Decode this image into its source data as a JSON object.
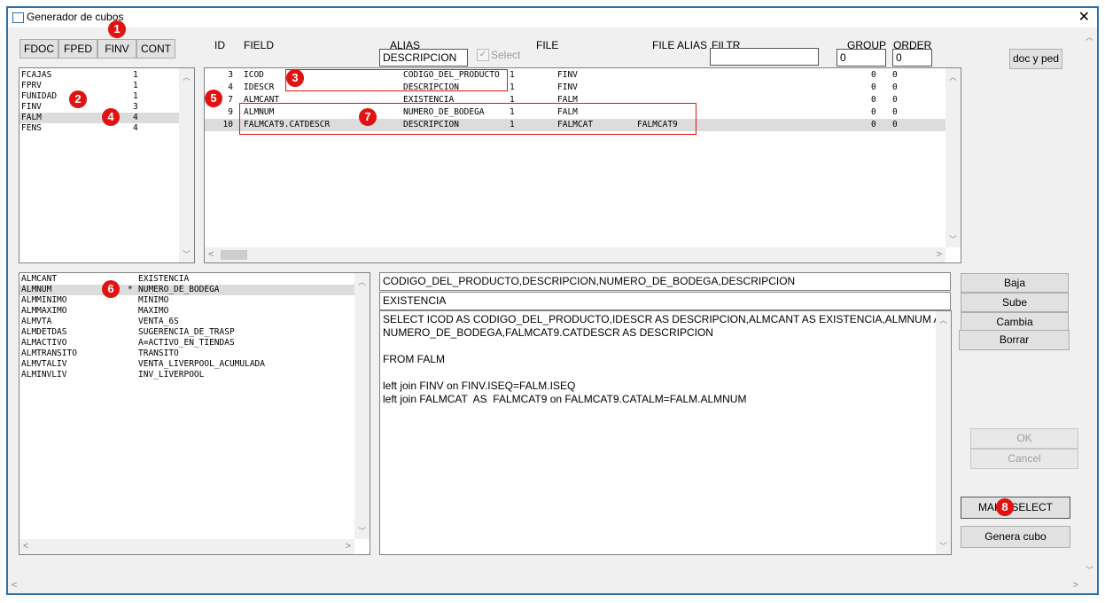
{
  "window": {
    "title": "Generador de cubos",
    "close": "✕"
  },
  "file_tabs": [
    "FDOC",
    "FPED",
    "FINV",
    "CONT"
  ],
  "columns": {
    "id": "ID",
    "field": "FIELD",
    "alias": "ALIAS",
    "file": "FILE",
    "file_alias": "FILE ALIAS",
    "filtr": "FILTR",
    "group": "GROUP",
    "order": "ORDER"
  },
  "alias_input": "DESCRIPCION",
  "select_checkbox_label": "Select",
  "filtr_input": "",
  "group_input": "0",
  "order_input": "0",
  "doc_button": "doc y ped",
  "files_list": [
    {
      "name": "FCAJAS",
      "count": "1"
    },
    {
      "name": "FPRV",
      "count": "1"
    },
    {
      "name": "FUNIDAD",
      "count": "1"
    },
    {
      "name": "FINV",
      "count": "3"
    },
    {
      "name": "FALM",
      "count": "4"
    },
    {
      "name": "FENS",
      "count": "4"
    }
  ],
  "fields_grid": [
    {
      "id": "3",
      "field": "ICOD",
      "alias": "CODIGO_DEL_PRODUCTO",
      "n": "1",
      "file": "FINV",
      "file_alias": "",
      "group": "0",
      "order": "0"
    },
    {
      "id": "4",
      "field": "IDESCR",
      "alias": "DESCRIPCION",
      "n": "1",
      "file": "FINV",
      "file_alias": "",
      "group": "0",
      "order": "0"
    },
    {
      "id": "7",
      "field": "ALMCANT",
      "alias": "EXISTENCIA",
      "n": "1",
      "file": "FALM",
      "file_alias": "",
      "group": "0",
      "order": "0"
    },
    {
      "id": "9",
      "field": "ALMNUM",
      "alias": "NUMERO_DE_BODEGA",
      "n": "1",
      "file": "FALM",
      "file_alias": "",
      "group": "0",
      "order": "0"
    },
    {
      "id": "10",
      "field": "FALMCAT9.CATDESCR",
      "alias": "DESCRIPCION",
      "n": "1",
      "file": "FALMCAT",
      "file_alias": "FALMCAT9",
      "group": "0",
      "order": "0"
    }
  ],
  "available_fields": [
    {
      "name": "ALMCANT",
      "mark": "",
      "alias": "EXISTENCIA"
    },
    {
      "name": "ALMNUM",
      "mark": "*",
      "alias": "NUMERO_DE_BODEGA"
    },
    {
      "name": "ALMMINIMO",
      "mark": "",
      "alias": "MINIMO"
    },
    {
      "name": "ALMMAXIMO",
      "mark": "",
      "alias": "MAXIMO"
    },
    {
      "name": "ALMVTA",
      "mark": "",
      "alias": "VENTA_6S"
    },
    {
      "name": "ALMDETDAS",
      "mark": "",
      "alias": "SUGERENCIA_DE_TRASP"
    },
    {
      "name": "ALMACTIVO",
      "mark": "",
      "alias": "A=ACTIVO_EN_TIENDAS"
    },
    {
      "name": "ALMTRANSITO",
      "mark": "",
      "alias": "TRANSITO"
    },
    {
      "name": "ALMVTALIV",
      "mark": "",
      "alias": "VENTA_LIVERPOOL_ACUMULADA"
    },
    {
      "name": "ALMINVLIV",
      "mark": "",
      "alias": "INV_LIVERPOOL"
    }
  ],
  "columns_summary": "CODIGO_DEL_PRODUCTO,DESCRIPCION,NUMERO_DE_BODEGA,DESCRIPCION",
  "group_summary": "EXISTENCIA",
  "sql_lines": [
    "SELECT ICOD AS CODIGO_DEL_PRODUCTO,IDESCR AS DESCRIPCION,ALMCANT AS EXISTENCIA,ALMNUM AS",
    "NUMERO_DE_BODEGA,FALMCAT9.CATDESCR AS DESCRIPCION",
    "",
    "FROM FALM",
    "",
    "left join FINV on FINV.ISEQ=FALM.ISEQ",
    "left join FALMCAT  AS  FALMCAT9 on FALMCAT9.CATALM=FALM.ALMNUM"
  ],
  "side_buttons": {
    "baja": "Baja",
    "sube": "Sube",
    "cambia": "Cambia",
    "borrar": "Borrar"
  },
  "ok_button": "OK",
  "cancel_button": "Cancel",
  "make_select_button": "MAKE SELECT",
  "genera_button": "Genera cubo",
  "annotations": [
    "1",
    "2",
    "3",
    "4",
    "5",
    "6",
    "7",
    "8"
  ],
  "colors": {
    "annotation": "#e01313",
    "frame": "#2f6fa8"
  }
}
